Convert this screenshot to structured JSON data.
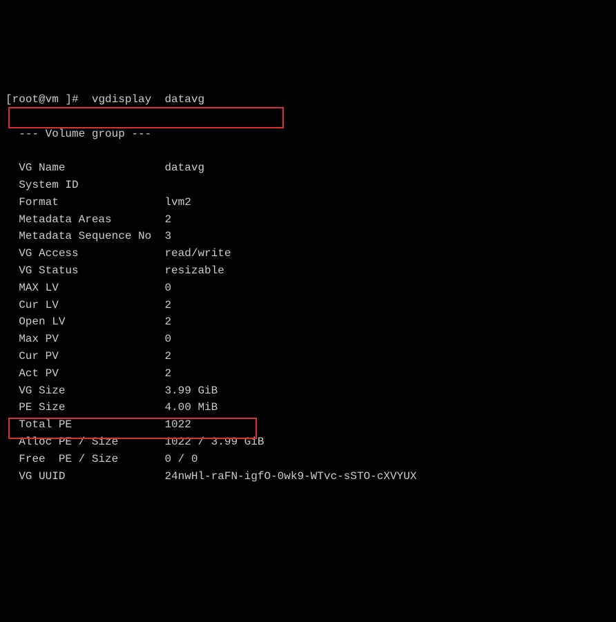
{
  "prompt": {
    "open_bracket": "[",
    "user": "root",
    "at": "@",
    "host": "vm",
    "close": " ]# ",
    "command": " vgdisplay  datavg"
  },
  "header": "  --- Volume group ---",
  "rows": [
    {
      "label": "  VG Name",
      "value": "datavg"
    },
    {
      "label": "  System ID",
      "value": ""
    },
    {
      "label": "  Format",
      "value": "lvm2"
    },
    {
      "label": "  Metadata Areas",
      "value": "2"
    },
    {
      "label": "  Metadata Sequence No",
      "value": "3"
    },
    {
      "label": "  VG Access",
      "value": "read/write"
    },
    {
      "label": "  VG Status",
      "value": "resizable"
    },
    {
      "label": "  MAX LV",
      "value": "0"
    },
    {
      "label": "  Cur LV",
      "value": "2"
    },
    {
      "label": "  Open LV",
      "value": "2"
    },
    {
      "label": "  Max PV",
      "value": "0"
    },
    {
      "label": "  Cur PV",
      "value": "2"
    },
    {
      "label": "  Act PV",
      "value": "2"
    },
    {
      "label": "  VG Size",
      "value": "3.99 GiB"
    },
    {
      "label": "  PE Size",
      "value": "4.00 MiB"
    },
    {
      "label": "  Total PE",
      "value": "1022"
    },
    {
      "label": "  Alloc PE / Size",
      "value": "1022 / 3.99 GiB"
    },
    {
      "label": "  Free  PE / Size",
      "value": "0 / 0"
    },
    {
      "label": "  VG UUID",
      "value": "24nwHl-raFN-igfO-0wk9-WTvc-sSTO-cXVYUX"
    }
  ],
  "label_width": 24
}
